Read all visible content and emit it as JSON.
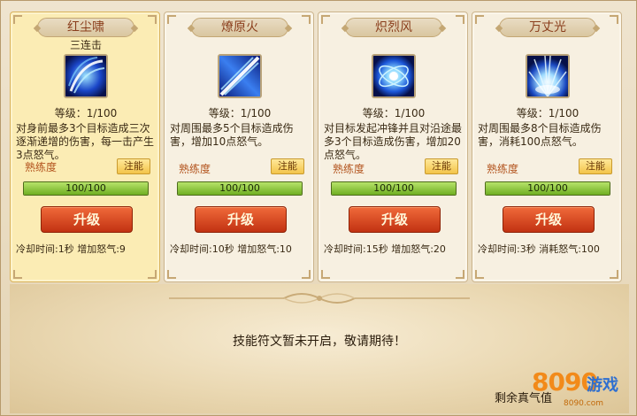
{
  "skills": [
    {
      "name": "红尘啸",
      "subtitle": "三连击",
      "level": "等级：1/100",
      "description": "对身前最多3个目标造成三次逐渐递增的伤害，每一击产生3点怒气。",
      "mastery_label": "熟练度",
      "inject_label": "注能",
      "progress_text": "100/100",
      "progress_fraction": 1.0,
      "upgrade_label": "升级",
      "stats": "冷却时间:1秒  增加怒气:9",
      "selected": true,
      "icon": "triple-strike-icon"
    },
    {
      "name": "燎原火",
      "subtitle": "",
      "level": "等级：1/100",
      "description": "对周围最多5个目标造成伤害，增加10点怒气。",
      "mastery_label": "熟练度",
      "inject_label": "注能",
      "progress_text": "100/100",
      "progress_fraction": 1.0,
      "upgrade_label": "升级",
      "stats": "冷却时间:10秒  增加怒气:10",
      "selected": false,
      "icon": "slash-icon"
    },
    {
      "name": "炽烈风",
      "subtitle": "",
      "level": "等级：1/100",
      "description": "对目标发起冲锋并且对沿途最多3个目标造成伤害，增加20点怒气。",
      "mastery_label": "熟练度",
      "inject_label": "注能",
      "progress_text": "100/100",
      "progress_fraction": 1.0,
      "upgrade_label": "升级",
      "stats": "冷却时间:15秒  增加怒气:20",
      "selected": false,
      "icon": "burst-icon"
    },
    {
      "name": "万丈光",
      "subtitle": "",
      "level": "等级：1/100",
      "description": "对周围最多8个目标造成伤害，消耗100点怒气。",
      "mastery_label": "熟练度",
      "inject_label": "注能",
      "progress_text": "100/100",
      "progress_fraction": 1.0,
      "upgrade_label": "升级",
      "stats": "冷却时间:3秒  消耗怒气:100",
      "selected": false,
      "icon": "light-pillar-icon"
    }
  ],
  "rune_panel": {
    "message": "技能符文暂未开启，敬请期待！",
    "remaining_label": "剩余真气值"
  },
  "watermark": {
    "number": "8090",
    "game": "游戏",
    "url": "8090.com"
  },
  "colors": {
    "accent_orange": "#c23212",
    "progress_green": "#6fae22",
    "title_brown": "#8a3e1c"
  }
}
